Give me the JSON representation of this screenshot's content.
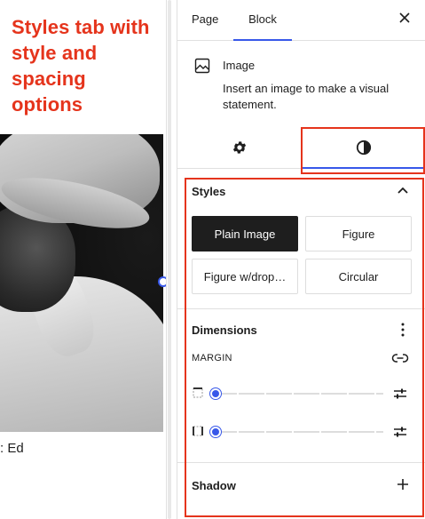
{
  "annotation": {
    "text": "Styles tab with style and spacing options"
  },
  "canvas": {
    "caption": ": Ed"
  },
  "sidebar": {
    "tabs": [
      {
        "label": "Page"
      },
      {
        "label": "Block"
      }
    ],
    "close_icon": "close-icon",
    "block": {
      "name": "Image",
      "description": "Insert an image to make a visual statement."
    },
    "sub_tabs": [
      {
        "icon": "gear-icon"
      },
      {
        "icon": "contrast-icon"
      }
    ],
    "styles": {
      "title": "Styles",
      "options": [
        {
          "label": "Plain Image",
          "active": true
        },
        {
          "label": "Figure",
          "active": false
        },
        {
          "label": "Figure w/drop…",
          "active": false
        },
        {
          "label": "Circular",
          "active": false
        }
      ]
    },
    "dimensions": {
      "title": "Dimensions",
      "margin_label": "MARGIN",
      "margin_top_value": 0,
      "margin_bottom_value": 0
    },
    "shadow": {
      "title": "Shadow"
    }
  },
  "colors": {
    "accent": "#3858e9",
    "annotation": "#e5341c",
    "text": "#1e1e1e"
  }
}
